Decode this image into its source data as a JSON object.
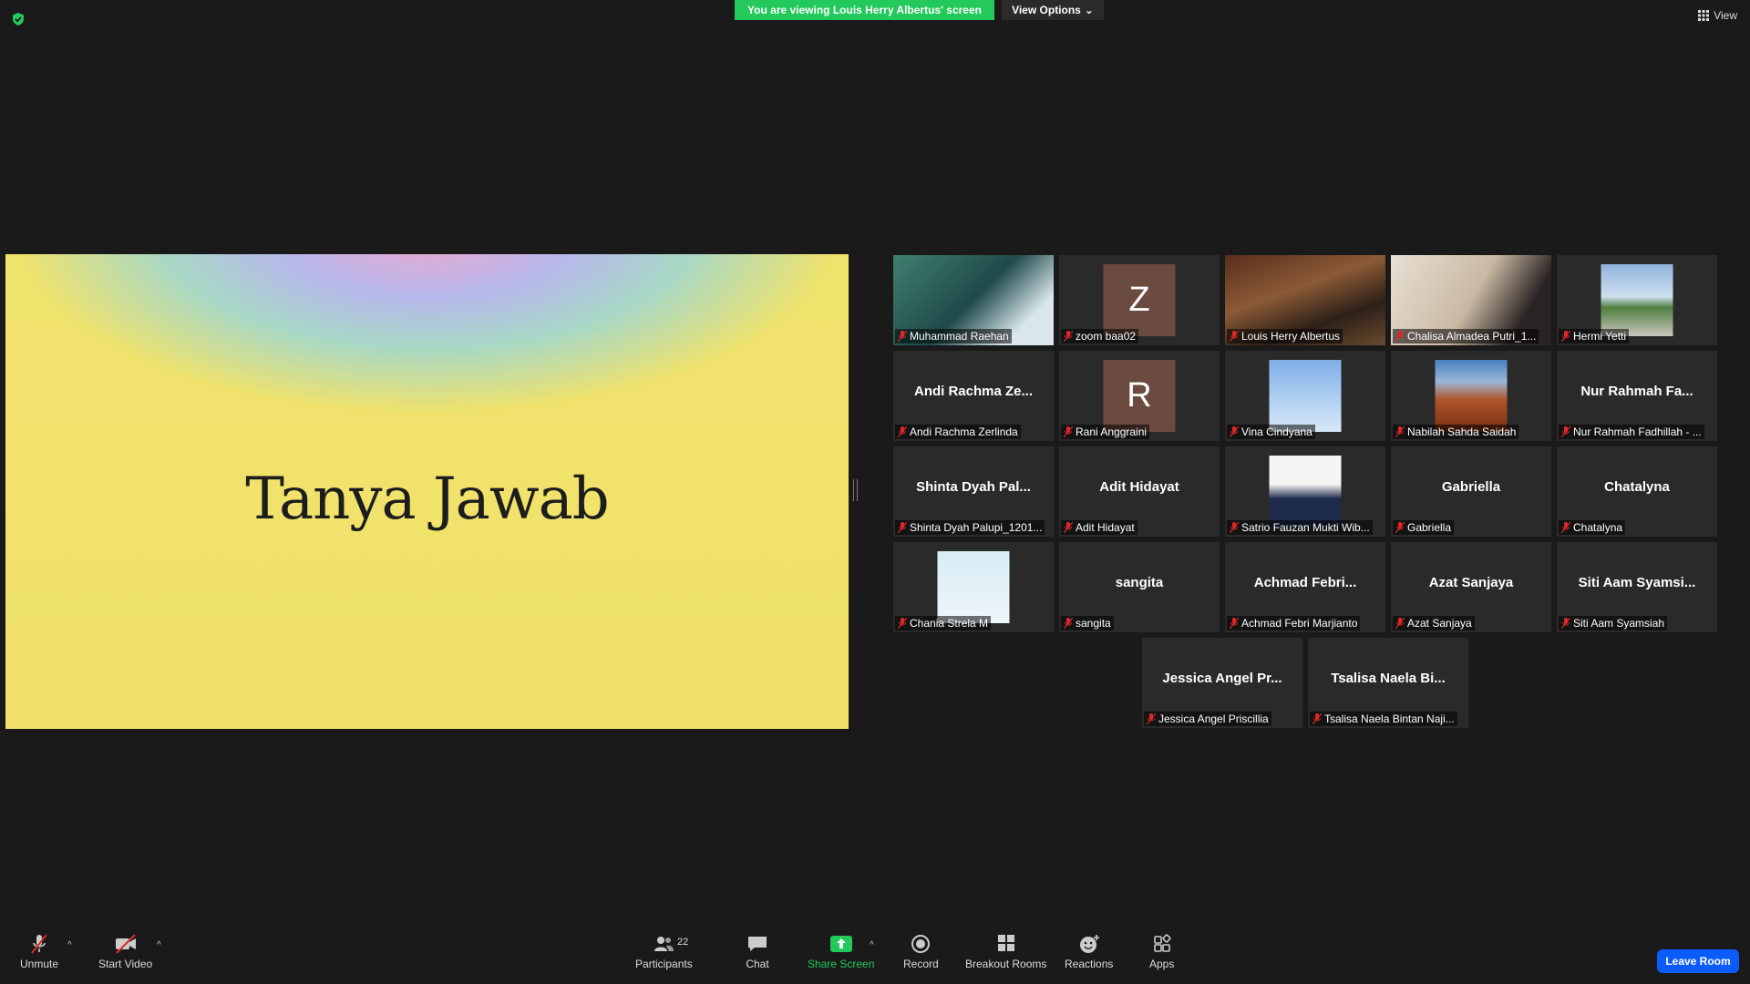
{
  "banner": {
    "viewing_text": "You are viewing Louis Herry Albertus' screen",
    "view_options_label": "View Options",
    "view_label": "View"
  },
  "share": {
    "title": "Tanya Jawab"
  },
  "participants": [
    {
      "name": "Muhammad Raehan",
      "display": "video"
    },
    {
      "name": "zoom baa02",
      "display": "letter",
      "letter": "Z"
    },
    {
      "name": "Louis Herry Albertus",
      "display": "video",
      "active": true
    },
    {
      "name": "Chalisa Almadea Putri_1...",
      "display": "video"
    },
    {
      "name": "Hermi Yetti",
      "display": "photo"
    },
    {
      "name": "Andi Rachma Zerlinda",
      "big": "Andi Rachma Ze..."
    },
    {
      "name": "Rani Anggraini",
      "display": "letter",
      "letter": "R"
    },
    {
      "name": "Vina Cindyana",
      "display": "photo"
    },
    {
      "name": "Nabilah Sahda Saidah",
      "display": "photo"
    },
    {
      "name": "Nur Rahmah Fadhillah - ...",
      "big": "Nur Rahmah Fa..."
    },
    {
      "name": "Shinta Dyah Palupi_1201...",
      "big": "Shinta Dyah Pal..."
    },
    {
      "name": "Adit Hidayat",
      "big": "Adit Hidayat"
    },
    {
      "name": "Satrio Fauzan Mukti Wib...",
      "display": "photo"
    },
    {
      "name": "Gabriella",
      "big": "Gabriella"
    },
    {
      "name": "Chatalyna",
      "big": "Chatalyna"
    },
    {
      "name": "Chania Strela M",
      "display": "photo"
    },
    {
      "name": "sangita",
      "big": "sangita"
    },
    {
      "name": "Achmad Febri Marjianto",
      "big": "Achmad Febri..."
    },
    {
      "name": "Azat Sanjaya",
      "big": "Azat Sanjaya"
    },
    {
      "name": "Siti Aam Syamsiah",
      "big": "Siti Aam Syamsi..."
    },
    {
      "name": "Jessica Angel Priscillia",
      "big": "Jessica Angel Pr..."
    },
    {
      "name": "Tsalisa Naela Bintan Naji...",
      "big": "Tsalisa Naela Bi..."
    }
  ],
  "toolbar": {
    "unmute": "Unmute",
    "start_video": "Start Video",
    "participants": "Participants",
    "participants_count": "22",
    "chat": "Chat",
    "share_screen": "Share Screen",
    "record": "Record",
    "breakout_rooms": "Breakout Rooms",
    "reactions": "Reactions",
    "apps": "Apps",
    "leave": "Leave Room"
  },
  "colors": {
    "banner_green": "#23c95a",
    "active_border": "#e8ea6a",
    "leave_blue": "#0b5cff"
  }
}
